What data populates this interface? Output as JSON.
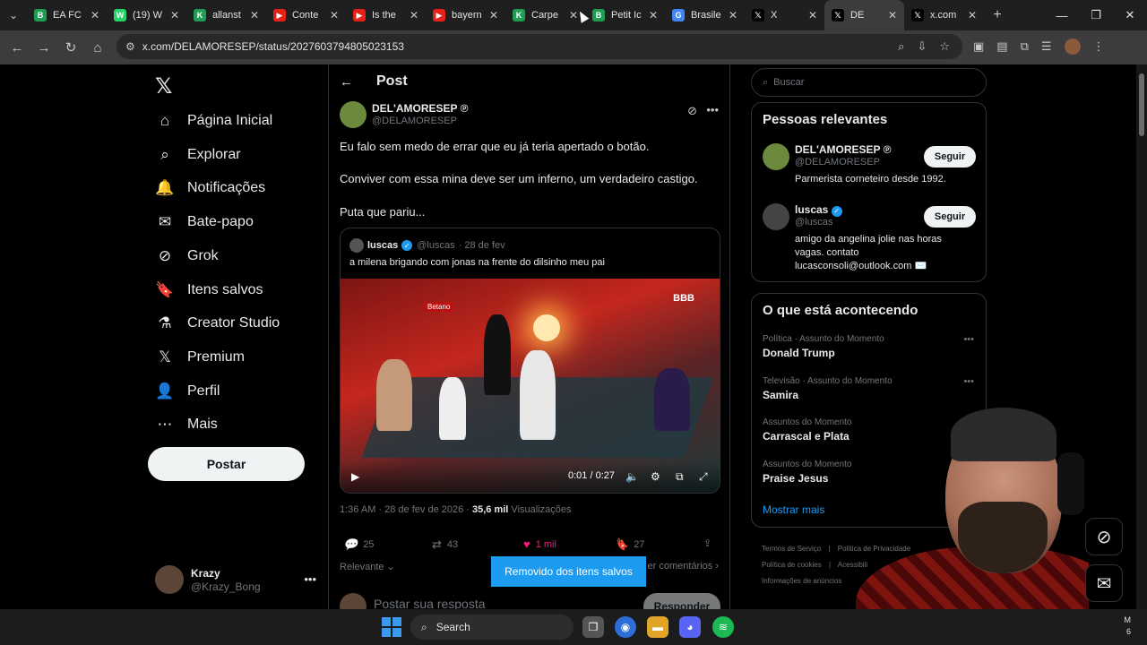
{
  "browser": {
    "tabs": [
      {
        "title": "EA FC",
        "color": "#1f9d55",
        "glyph": "B"
      },
      {
        "title": "(19) W",
        "color": "#25d366",
        "glyph": "W"
      },
      {
        "title": "allanst",
        "color": "#1f9d55",
        "glyph": "K"
      },
      {
        "title": "Conte",
        "color": "#e62117",
        "glyph": "▶"
      },
      {
        "title": "Is the",
        "color": "#e62117",
        "glyph": "▶"
      },
      {
        "title": "bayern",
        "color": "#e62117",
        "glyph": "▶"
      },
      {
        "title": "Carpe",
        "color": "#1f9d55",
        "glyph": "K"
      },
      {
        "title": "Petit Ic",
        "color": "#1f9d55",
        "glyph": "B"
      },
      {
        "title": "Brasile",
        "color": "#4285f4",
        "glyph": "G"
      },
      {
        "title": "X",
        "color": "#000000",
        "glyph": "𝕏"
      },
      {
        "title": "DE",
        "color": "#000000",
        "glyph": "𝕏"
      },
      {
        "title": "x.com",
        "color": "#000000",
        "glyph": "𝕏"
      }
    ],
    "active_tab_index": 10,
    "url": "x.com/DELAMORESEP/status/2027603794805023153"
  },
  "sidebar": {
    "items": [
      {
        "label": "Página Inicial",
        "icon": "home-icon"
      },
      {
        "label": "Explorar",
        "icon": "search-icon"
      },
      {
        "label": "Notificações",
        "icon": "bell-icon"
      },
      {
        "label": "Bate-papo",
        "icon": "mail-icon"
      },
      {
        "label": "Grok",
        "icon": "grok-icon"
      },
      {
        "label": "Itens salvos",
        "icon": "bookmark-icon"
      },
      {
        "label": "Creator Studio",
        "icon": "flask-icon"
      },
      {
        "label": "Premium",
        "icon": "x-logo-icon"
      },
      {
        "label": "Perfil",
        "icon": "person-icon"
      },
      {
        "label": "Mais",
        "icon": "more-circle-icon"
      }
    ],
    "post_button": "Postar",
    "account": {
      "name": "Krazy",
      "handle": "@Krazy_Bong"
    }
  },
  "post": {
    "header": "Post",
    "author_name": "DEL'AMORESEP ℗",
    "author_handle": "@DELAMORESEP",
    "text_lines": [
      "Eu falo sem medo de errar que eu já teria apertado o botão.",
      "Conviver com essa mina deve ser um inferno, um verdadeiro castigo.",
      "Puta que pariu..."
    ],
    "quote": {
      "name": "luscas",
      "handle": "@luscas",
      "date": "· 28 de fev",
      "text": "a milena brigando com jonas na frente do dilsinho meu pai",
      "video_time": "0:01 / 0:27"
    },
    "timestamp": "1:36 AM · 28 de fev de 2026 ·",
    "views_count": "35,6 mil",
    "views_label": "Visualizações",
    "replies": "25",
    "reposts": "43",
    "likes": "1 mil",
    "bookmarks": "27",
    "sort_label": "Relevante",
    "more_comments": "er comentários",
    "toast": "Removido dos itens salvos",
    "reply_placeholder": "Postar sua resposta",
    "reply_button": "Responder"
  },
  "right": {
    "search_placeholder": "Buscar",
    "relevant_title": "Pessoas relevantes",
    "people": [
      {
        "name": "DEL'AMORESEP ℗",
        "handle": "@DELAMORESEP",
        "bio": "Parmerista corneteiro desde 1992.",
        "follow": "Seguir",
        "color": "#6b8a3e"
      },
      {
        "name": "luscas",
        "handle": "@luscas",
        "bio": "amigo da angelina jolie nas horas vagas. contato lucasconsoli@outlook.com ✉️",
        "follow": "Seguir",
        "color": "#444"
      }
    ],
    "trends_title": "O que está acontecendo",
    "trends": [
      {
        "category": "Política · Assunto do Momento",
        "name": "Donald Trump"
      },
      {
        "category": "Televisão · Assunto do Momento",
        "name": "Samira"
      },
      {
        "category": "Assuntos do Momento",
        "name": "Carrascal e Plata"
      },
      {
        "category": "Assuntos do Momento",
        "name": "Praise Jesus"
      }
    ],
    "show_more": "Mostrar mais",
    "footer": [
      "Termos de Serviço",
      "|",
      "Política de Privacidade",
      "Política de cookies",
      "|",
      "Acessibili",
      "Informações de anúncios"
    ]
  },
  "taskbar": {
    "search_label": "Search",
    "clock_line1": "M",
    "clock_line2": "6"
  }
}
